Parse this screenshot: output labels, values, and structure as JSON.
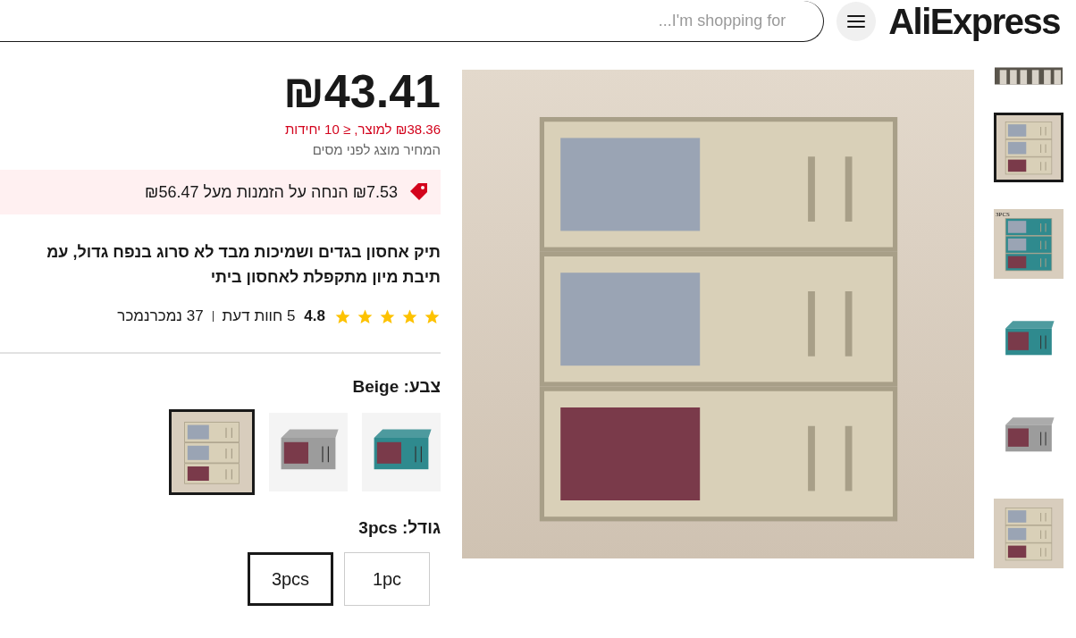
{
  "header": {
    "logo": "AliExpress",
    "search": {
      "placeholder": "I'm shopping for..."
    }
  },
  "gallery": {
    "thumbnails": [
      {
        "kind": "hanging",
        "color": "#d8d2c8",
        "selected": false
      },
      {
        "kind": "stack",
        "color": "#d9d0b8",
        "selected": true
      },
      {
        "kind": "stack",
        "color": "#2f8a8e",
        "selected": false,
        "caption": "3PCS"
      },
      {
        "kind": "single",
        "color": "#2f8a8e",
        "selected": false
      },
      {
        "kind": "single",
        "color": "#9c9c9c",
        "selected": false
      },
      {
        "kind": "stack",
        "color": "#d9d0b8",
        "selected": false
      }
    ],
    "main": {
      "kind": "stack"
    }
  },
  "price": {
    "current": "₪43.41",
    "unit_price": "₪38.36 למוצר, ≤ 10 יחידות",
    "tax_note": "המחיר מוצג לפני מסים"
  },
  "discount": {
    "text": "₪7.53 הנחה על הזמנות מעל ₪56.47"
  },
  "title_lines": [
    "תיק אחסון בגדים ושמיכות מבד לא סרוג בנפח גדול, עמ",
    "תיבת מיון מתקפלת לאחסון ביתי"
  ],
  "rating": {
    "stars": 5,
    "score": "4.8",
    "reviews": "5 חוות דעת",
    "sold": "37 נמכרנמכר"
  },
  "color_option": {
    "label": "צבע: Beige",
    "options": [
      {
        "kind": "single",
        "color": "#2f8a8e",
        "selected": false
      },
      {
        "kind": "single",
        "color": "#9c9c9c",
        "selected": false
      },
      {
        "kind": "stack",
        "color": "#d9d0b8",
        "selected": true
      }
    ]
  },
  "size_option": {
    "label": "גודל: 3pcs",
    "options": [
      {
        "label": "1pc",
        "selected": false
      },
      {
        "label": "3pcs",
        "selected": true
      }
    ]
  }
}
